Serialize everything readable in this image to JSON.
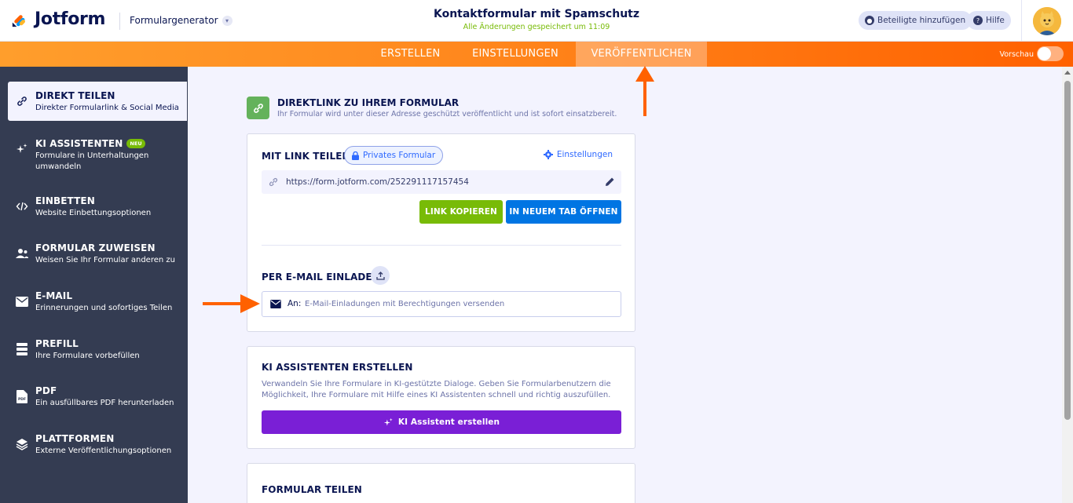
{
  "header": {
    "brand": "Jotform",
    "generator_label": "Formulargenerator",
    "form_title": "Kontaktformular mit Spamschutz",
    "save_status": "Alle Änderungen gespeichert um 11:09",
    "add_participants": "Beteiligte hinzufügen",
    "help": "Hilfe"
  },
  "navbar": {
    "tabs": [
      "ERSTELLEN",
      "EINSTELLUNGEN",
      "VERÖFFENTLICHEN"
    ],
    "active_tab": "VERÖFFENTLICHEN",
    "preview_label": "Vorschau"
  },
  "sidebar": {
    "items": [
      {
        "title": "DIREKT TEILEN",
        "subtitle": "Direkter Formularlink & Social Media",
        "icon": "link-icon",
        "active": true
      },
      {
        "title": "KI ASSISTENTEN",
        "badge": "NEU",
        "subtitle": "Formulare in Unterhaltungen umwandeln",
        "icon": "sparkle-icon"
      },
      {
        "title": "EINBETTEN",
        "subtitle": "Website Einbettungsoptionen",
        "icon": "code-icon"
      },
      {
        "title": "FORMULAR ZUWEISEN",
        "subtitle": "Weisen Sie Ihr Formular anderen zu",
        "icon": "assign-user-icon"
      },
      {
        "title": "E-MAIL",
        "subtitle": "Erinnerungen und sofortiges Teilen",
        "icon": "envelope-icon"
      },
      {
        "title": "PREFILL",
        "subtitle": "Ihre Formulare vorbefüllen",
        "icon": "prefill-icon"
      },
      {
        "title": "PDF",
        "subtitle": "Ein ausfüllbares PDF herunterladen",
        "icon": "pdf-icon"
      },
      {
        "title": "PLATTFORMEN",
        "subtitle": "Externe Veröffentlichungsoptionen",
        "icon": "layers-icon"
      }
    ]
  },
  "main": {
    "direct_link": {
      "title": "DIREKTLINK ZU IHREM FORMULAR",
      "subtitle": "Ihr Formular wird unter dieser Adresse geschützt veröffentlicht und ist sofort einsatzbereit."
    },
    "share_card": {
      "title": "MIT LINK TEILEN",
      "privacy_label": "Privates Formular",
      "settings_label": "Einstellungen",
      "url": "https://form.jotform.com/252291117157454",
      "copy_button": "LINK KOPIEREN",
      "open_button": "IN NEUEM TAB ÖFFNEN",
      "invite_title": "PER E-MAIL EINLADEN",
      "to_label": "An:",
      "email_placeholder": "E-Mail-Einladungen mit Berechtigungen versenden"
    },
    "ai_card": {
      "title": "KI ASSISTENTEN ERSTELLEN",
      "description": "Verwandeln Sie Ihre Formulare in KI-gestützte Dialoge. Geben Sie Formularbenutzern die Möglichkeit, Ihre Formulare mit Hilfe eines KI Assistenten schnell und richtig auszufüllen.",
      "button": "KI Assistent erstellen"
    },
    "share_form_card": {
      "title": "FORMULAR TEILEN"
    }
  },
  "colors": {
    "accent_orange": "#ff6100",
    "green": "#78bb07",
    "blue": "#0075e3",
    "purple": "#7a1fd6",
    "sidebar_bg": "#343c52"
  }
}
